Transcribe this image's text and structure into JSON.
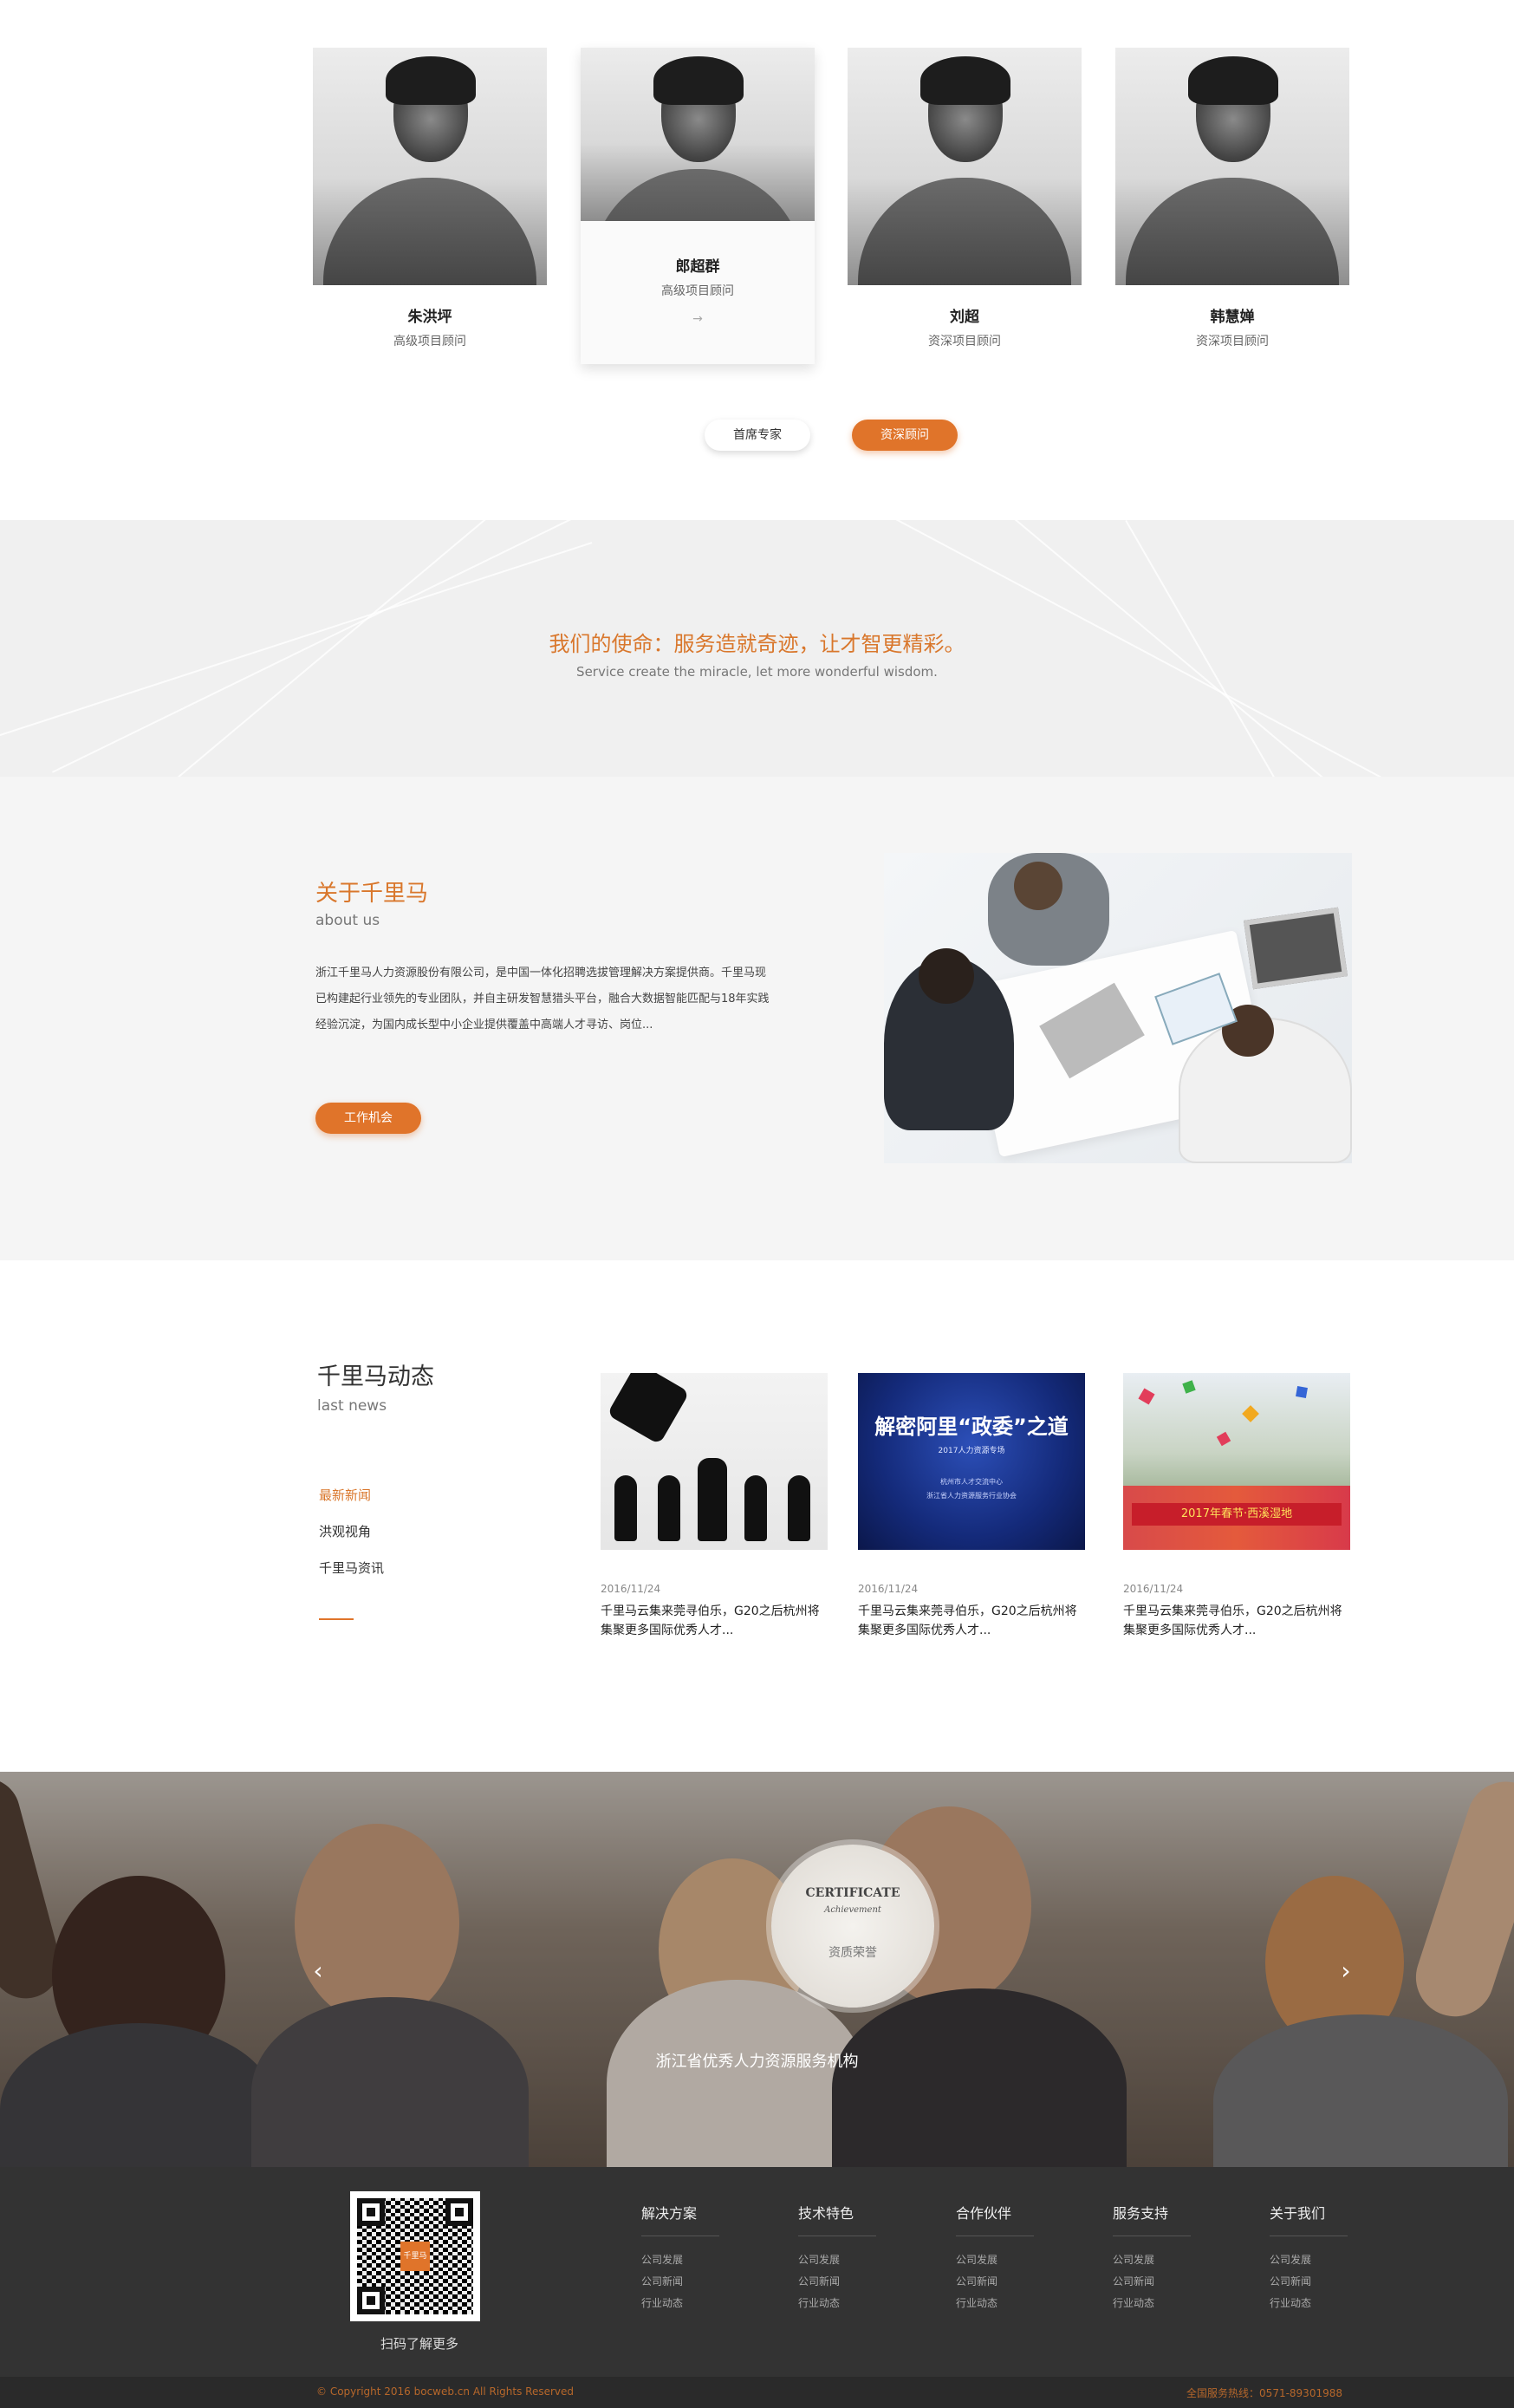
{
  "team": {
    "members": [
      {
        "name": "朱洪坪",
        "role": "高级项目顾问"
      },
      {
        "name": "郎超群",
        "role": "高级项目顾问"
      },
      {
        "name": "刘超",
        "role": "资深项目顾问"
      },
      {
        "name": "韩慧婵",
        "role": "资深项目顾问"
      }
    ],
    "arrow": "→",
    "tabs": {
      "first": "首席专家",
      "second": "资深顾问"
    }
  },
  "mission": {
    "cn": "我们的使命：服务造就奇迹，让才智更精彩。",
    "en": "Service create the miracle, let more wonderful wisdom."
  },
  "about": {
    "title": "关于千里马",
    "subtitle": "about us",
    "text": "浙江千里马人力资源股份有限公司，是中国一体化招聘选拔管理解决方案提供商。千里马现已构建起行业领先的专业团队，并自主研发智慧猎头平台，融合大数据智能匹配与18年实践经验沉淀，为国内成长型中小企业提供覆盖中高端人才寻访、岗位...",
    "button": "工作机会"
  },
  "news": {
    "title": "千里马动态",
    "subtitle": "last news",
    "categories": [
      "最新新闻",
      "洪观视角",
      "千里马资讯"
    ],
    "items": [
      {
        "date": "2016/11/24",
        "text": "千里马云集来莞寻伯乐，G20之后杭州将集聚更多国际优秀人才..."
      },
      {
        "date": "2016/11/24",
        "text": "千里马云集来莞寻伯乐，G20之后杭州将集聚更多国际优秀人才...",
        "image_title": "解密阿里“政委”之道",
        "image_sub": "2017人力资源专场",
        "image_lines": [
          "杭州市人才交流中心",
          "浙江省人力资源服务行业协会"
        ]
      },
      {
        "date": "2016/11/24",
        "text": "千里马云集来莞寻伯乐，G20之后杭州将集聚更多国际优秀人才...",
        "banner": "2017年春节·西溪湿地"
      }
    ]
  },
  "honor": {
    "cert_title": "CERTIFICATE",
    "cert_sub": "Achievement",
    "cert_label": "资质荣誉",
    "caption": "浙江省优秀人力资源服务机构",
    "prev": "‹",
    "next": "›"
  },
  "footer": {
    "qr_logo": "千里马",
    "qr_caption": "扫码了解更多",
    "columns": [
      {
        "title": "解决方案",
        "links": [
          "公司发展",
          "公司新闻",
          "行业动态"
        ]
      },
      {
        "title": "技术特色",
        "links": [
          "公司发展",
          "公司新闻",
          "行业动态"
        ]
      },
      {
        "title": "合作伙伴",
        "links": [
          "公司发展",
          "公司新闻",
          "行业动态"
        ]
      },
      {
        "title": "服务支持",
        "links": [
          "公司发展",
          "公司新闻",
          "行业动态"
        ]
      },
      {
        "title": "关于我们",
        "links": [
          "公司发展",
          "公司新闻",
          "行业动态"
        ]
      }
    ],
    "copyright": "© Copyright 2016 bocweb.cn All Rights Reserved",
    "hotline": "全国服务热线：0571-89301988"
  },
  "colors": {
    "accent": "#e0742a",
    "footer_bg": "#333333"
  }
}
